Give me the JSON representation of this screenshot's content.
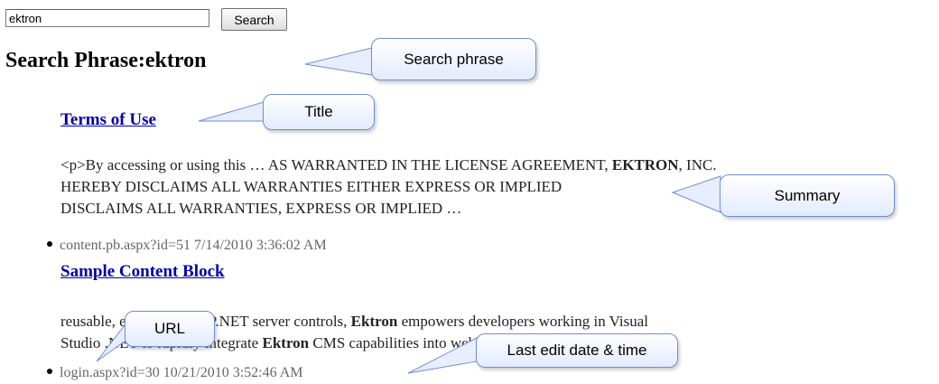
{
  "search": {
    "input_value": "ektron",
    "button_label": "Search"
  },
  "page": {
    "title_label": "Search Phrase:",
    "title_phrase": "ektron"
  },
  "results": [
    {
      "title": "Terms of Use",
      "summary_lines": [
        [
          "<p>By accessing or using this … AS WARRANTED IN THE LICENSE AGREEMENT, ",
          {
            "bold": "EKTRON"
          },
          ", INC."
        ],
        [
          "HEREBY DISCLAIMS ALL WARRANTIES EITHER EXPRESS OR IMPLIED"
        ],
        [
          "DISCLAIMS ALL WARRANTIES, EXPRESS OR IMPLIED …"
        ]
      ],
      "url": "content.pb.aspx?id=51",
      "date": "7/14/2010 3:36:02 AM"
    },
    {
      "title": "Sample Content Block",
      "summary_lines": [
        [
          "reusable, extendable ASP.NET server controls, ",
          {
            "bold": "Ektron"
          },
          " empowers developers working in Visual"
        ],
        [
          "Studio .NET to rapidly integrate ",
          {
            "bold": "Ektron"
          },
          " CMS capabilities into web applications and sites. …"
        ]
      ],
      "url": "login.aspx?id=30",
      "date": "10/21/2010 3:52:46 AM"
    }
  ],
  "annotations": {
    "search_phrase": "Search phrase",
    "title": "Title",
    "summary": "Summary",
    "url": "URL",
    "last_edit": "Last edit date & time"
  },
  "colors": {
    "link": "#0000aa",
    "callout_border": "#6e8fd6",
    "meta_text": "#666666"
  }
}
